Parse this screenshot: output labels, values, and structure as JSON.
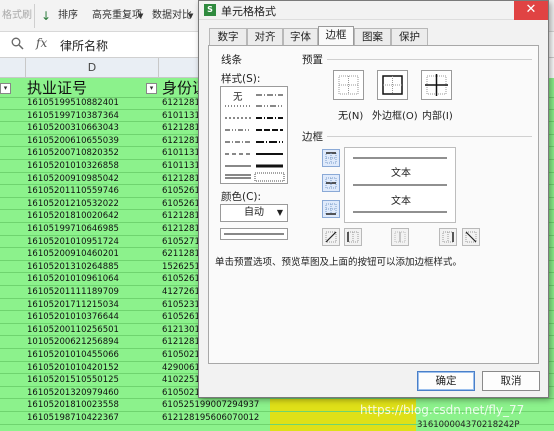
{
  "ribbon": {
    "items": [
      {
        "label": "格式刷",
        "disabled": true
      },
      {
        "label": "排序",
        "disabled": false
      },
      {
        "label": "高亮重复项",
        "disabled": false
      },
      {
        "label": "数据对比",
        "disabled": false
      }
    ]
  },
  "formula_bar": {
    "fx_label": "fx",
    "value": "律所名称"
  },
  "columns": {
    "d_header": "D"
  },
  "table": {
    "header_d": "执业证号",
    "header_e": "身份证",
    "rows_d": [
      "16105199510882401",
      "16105199710387364",
      "16105200310663043",
      "16105200610655039",
      "16105200710820352",
      "16105201010326858",
      "16105200910985042",
      "16105201110559746",
      "16105201210532022",
      "16105201810020642",
      "16105199710646985",
      "16105201010951724",
      "16105200910460201",
      "16105201310264885",
      "16105201010961064",
      "16105201111189709",
      "16105201711215034",
      "16105201010376644",
      "16105200110256501",
      "10105200621256894",
      "16105201010455066",
      "16105201010420152",
      "16105201510550125",
      "16105201320979460",
      "16105201810023558",
      "16105198710422367"
    ],
    "rows_e": [
      "61212819",
      "61011319",
      "61212819",
      "61212819",
      "61011319",
      "61011319",
      "61212819",
      "61052619",
      "61052619",
      "61212819",
      "61212819",
      "61052719",
      "62112819",
      "15262519",
      "61052619",
      "41272619",
      "61052319",
      "61052619",
      "61213019",
      "61212819",
      "61050219",
      "42900619",
      "41022519",
      "61050219",
      "610525199007294937",
      "612128195606070012"
    ],
    "last_row_extra": "316100004370218242P"
  },
  "dialog": {
    "title": "单元格格式",
    "close_symbol": "✕",
    "tabs": [
      "数字",
      "对齐",
      "字体",
      "边框",
      "图案",
      "保护"
    ],
    "active_tab": "边框",
    "line_section": "线条",
    "style_label": "样式(S):",
    "none_label": "无",
    "color_label": "颜色(C):",
    "color_value": "自动",
    "preset_section": "预置",
    "presets": [
      "无(N)",
      "外边框(O)",
      "内部(I)"
    ],
    "border_section": "边框",
    "preview_text": "文本",
    "hint": "单击预置选项、预览草图及上面的按钮可以添加边框样式。",
    "ok": "确定",
    "cancel": "取消"
  },
  "watermark": "https://blog.csdn.net/fly_77",
  "colors": {
    "green_fill": "#8cf28c",
    "yellow_fill": "#dfe018",
    "close_red": "#e04343"
  }
}
